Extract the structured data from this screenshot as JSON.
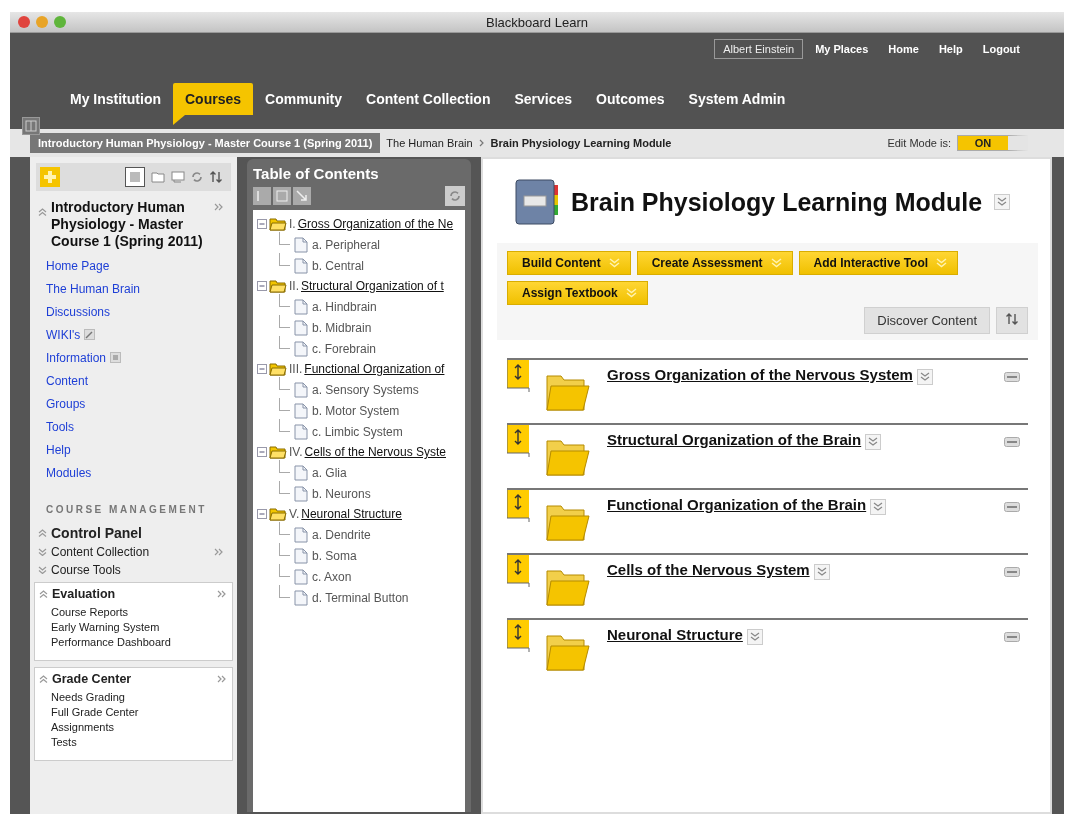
{
  "window": {
    "title": "Blackboard Learn"
  },
  "top_links": [
    {
      "label": "Albert Einstein",
      "kind": "user"
    },
    {
      "label": "My Places",
      "kind": "link"
    },
    {
      "label": "Home",
      "kind": "link"
    },
    {
      "label": "Help",
      "kind": "link"
    },
    {
      "label": "Logout",
      "kind": "link"
    }
  ],
  "tabs": [
    {
      "label": "My Institution",
      "selected": false
    },
    {
      "label": "Courses",
      "selected": true
    },
    {
      "label": "Community",
      "selected": false
    },
    {
      "label": "Content Collection",
      "selected": false
    },
    {
      "label": "Services",
      "selected": false
    },
    {
      "label": "Outcomes",
      "selected": false
    },
    {
      "label": "System Admin",
      "selected": false
    }
  ],
  "breadcrumb": {
    "course": "Introductory Human Physiology - Master Course 1 (Spring 2011)",
    "items": [
      "The Human Brain",
      "Brain Physiology Learning Module"
    ]
  },
  "edit_mode": {
    "label": "Edit Mode is:",
    "state_label": "ON",
    "on": true
  },
  "course_menu": {
    "title": "Introductory Human Physiology - Master Course 1 (Spring 2011)",
    "expanded": true,
    "links": [
      {
        "label": "Home Page",
        "kind": "plain"
      },
      {
        "label": "The Human Brain",
        "kind": "plain"
      },
      {
        "label": "Discussions",
        "kind": "plain"
      },
      {
        "label": "WIKI's",
        "kind": "pencil"
      },
      {
        "label": "Information",
        "kind": "box"
      },
      {
        "label": "Content",
        "kind": "plain"
      },
      {
        "label": "Groups",
        "kind": "plain"
      },
      {
        "label": "Tools",
        "kind": "plain"
      },
      {
        "label": "Help",
        "kind": "plain"
      },
      {
        "label": "Modules",
        "kind": "plain"
      }
    ]
  },
  "management": {
    "heading": "COURSE MANAGEMENT",
    "sections": [
      {
        "title": "Control Panel",
        "kind": "header",
        "expanded": true
      },
      {
        "title": "Content Collection",
        "kind": "row",
        "expanded": false,
        "more": true
      },
      {
        "title": "Course Tools",
        "kind": "row",
        "expanded": false,
        "more": false
      },
      {
        "title": "Evaluation",
        "kind": "box",
        "expanded": true,
        "items": [
          "Course Reports",
          "Early Warning System",
          "Performance Dashboard"
        ]
      },
      {
        "title": "Grade Center",
        "kind": "box",
        "expanded": true,
        "items": [
          "Needs Grading",
          "Full Grade Center",
          "Assignments",
          "Tests"
        ]
      }
    ]
  },
  "toc": {
    "title": "Table of Contents",
    "tree": [
      {
        "number": "I.",
        "label": "Gross Organization of the Ne",
        "expanded": true,
        "children": [
          {
            "label": "a. Peripheral"
          },
          {
            "label": "b. Central"
          }
        ]
      },
      {
        "number": "II.",
        "label": "Structural Organization of t",
        "expanded": true,
        "children": [
          {
            "label": "a. Hindbrain"
          },
          {
            "label": "b. Midbrain"
          },
          {
            "label": "c. Forebrain"
          }
        ]
      },
      {
        "number": "III.",
        "label": "Functional Organization of",
        "expanded": true,
        "children": [
          {
            "label": "a. Sensory Systems"
          },
          {
            "label": "b. Motor System"
          },
          {
            "label": "c. Limbic System"
          }
        ]
      },
      {
        "number": "IV.",
        "label": "Cells of the Nervous Syste",
        "expanded": true,
        "children": [
          {
            "label": "a. Glia"
          },
          {
            "label": "b. Neurons"
          }
        ]
      },
      {
        "number": "V.",
        "label": "Neuronal Structure",
        "expanded": true,
        "children": [
          {
            "label": "a. Dendrite"
          },
          {
            "label": "b. Soma"
          },
          {
            "label": "c. Axon"
          },
          {
            "label": "d. Terminal Button"
          }
        ]
      }
    ]
  },
  "module": {
    "title": "Brain Physiology Learning Module",
    "actions": [
      "Build Content",
      "Create Assessment",
      "Add Interactive Tool",
      "Assign Textbook"
    ],
    "discover": "Discover Content",
    "items": [
      {
        "title": "Gross Organization of the Nervous System"
      },
      {
        "title": "Structural Organization of the Brain"
      },
      {
        "title": "Functional Organization of the Brain"
      },
      {
        "title": "Cells of the Nervous System"
      },
      {
        "title": "Neuronal Structure"
      }
    ]
  }
}
